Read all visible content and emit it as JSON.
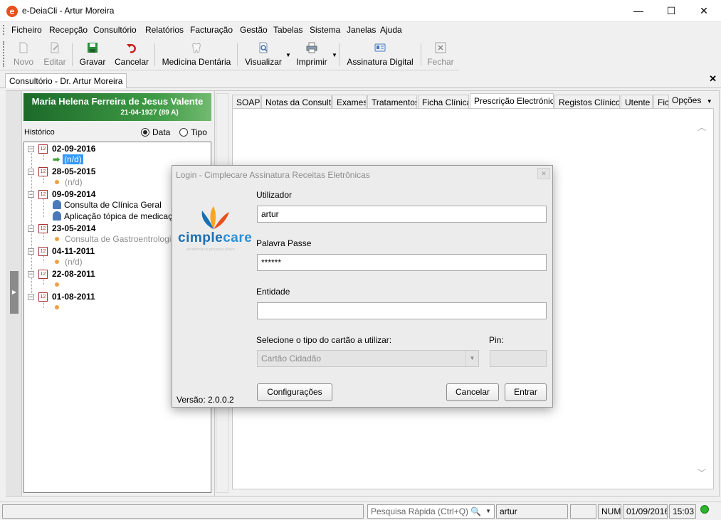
{
  "window": {
    "title": "e-DeiaCli - Artur Moreira",
    "icon_letter": "e",
    "minimize": "—",
    "maximize": "☐",
    "close": "✕"
  },
  "menu": [
    "Ficheiro",
    "Recepção",
    "Consultório",
    "Relatórios",
    "Facturação",
    "Gestão",
    "Tabelas",
    "Sistema",
    "Janelas",
    "Ajuda"
  ],
  "toolbar": {
    "novo": "Novo",
    "editar": "Editar",
    "gravar": "Gravar",
    "cancelar": "Cancelar",
    "medicina": "Medicina Dentária",
    "visualizar": "Visualizar",
    "imprimir": "Imprimir",
    "assinatura": "Assinatura Digital",
    "fechar": "Fechar"
  },
  "document_tab": {
    "label": "Consultório - Dr. Artur Moreira",
    "close": "✕"
  },
  "patient": {
    "name": "Maria Helena Ferreira de Jesus Valente",
    "dob": "21-04-1927 (89 A)"
  },
  "history": {
    "label": "Histórico",
    "radio_date": "Data",
    "radio_type": "Tipo",
    "calendar_glyph": "12",
    "expand_glyph": "−",
    "nodes": [
      {
        "date": "02-09-2016",
        "child": "(n/d)"
      },
      {
        "date": "28-05-2015",
        "child": "(n/d)"
      },
      {
        "date": "09-09-2014",
        "child": "Consulta de Clínica Geral",
        "child2": "Aplicação tópica de medicação"
      },
      {
        "date": "23-05-2014",
        "child": "Consulta de Gastroentrologia"
      },
      {
        "date": "04-11-2011",
        "child": "(n/d)"
      },
      {
        "date": "22-08-2011",
        "child": ""
      },
      {
        "date": "01-08-2011",
        "child": ""
      }
    ]
  },
  "tabs": [
    "SOAP",
    "Notas da Consulta",
    "Exames",
    "Tratamentos",
    "Ficha Clínica",
    "Prescrição Electrónica",
    "Registos Clínicos",
    "Utente",
    "Ficha"
  ],
  "tab_options": "Opções",
  "status": {
    "search_placeholder": "Pesquisa Rápida (Ctrl+Q)",
    "user": "artur",
    "num": "NUM",
    "date": "01/09/2016",
    "time": "15:03"
  },
  "login": {
    "title": "Login - Cimplecare Assinatura Receitas Eletrônicas",
    "logo_a": "cimple",
    "logo_b": "care",
    "logo_sub": "excelência no processo clínico",
    "user_label": "Utilizador",
    "user_value": "artur",
    "password_label": "Palavra Passe",
    "password_value": "******",
    "entity_label": "Entidade",
    "entity_value": "",
    "card_label": "Selecione o tipo do cartão a utilizar:",
    "card_value": "Cartão Cidadão",
    "pin_label": "Pin:",
    "config_button": "Configurações",
    "cancel_button": "Cancelar",
    "enter_button": "Entrar",
    "version": "Versão: 2.0.0.2"
  }
}
